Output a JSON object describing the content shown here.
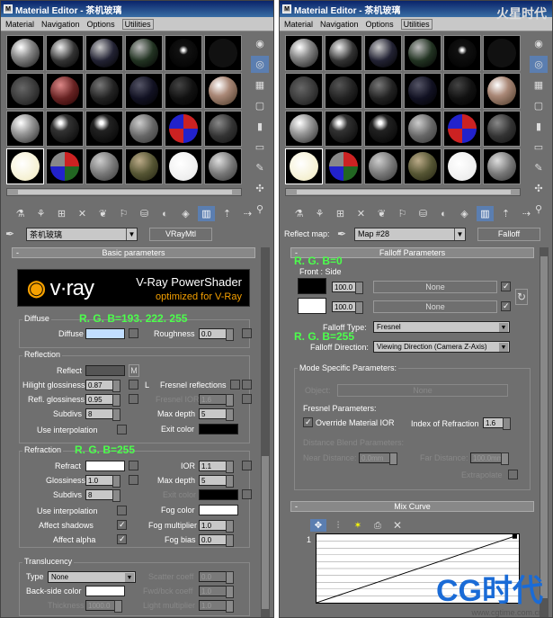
{
  "left": {
    "title": "Material Editor - 茶机玻璃",
    "menu": [
      "Material",
      "Navigation",
      "Options",
      "Utilities"
    ],
    "material_name": "茶机玻璃",
    "material_type": "VRayMtl",
    "rollout": "Basic parameters",
    "banner": {
      "logo": "v·ray",
      "line1": "V-Ray PowerShader",
      "line2": "optimized for V-Ray"
    },
    "diffuse": {
      "group": "Diffuse",
      "label": "Diffuse",
      "roughness_label": "Roughness",
      "roughness": "0.0"
    },
    "reflection": {
      "group": "Reflection",
      "reflect": "Reflect",
      "m": "M",
      "hilight_label": "Hilight glossiness",
      "hilight": "0.87",
      "l": "L",
      "fresnel_label": "Fresnel reflections",
      "refl_gloss_label": "Refl. glossiness",
      "refl_gloss": "0.95",
      "fresnel_ior_label": "Fresnel IOR",
      "fresnel_ior": "1.6",
      "subdivs_label": "Subdivs",
      "subdivs": "8",
      "maxdepth_label": "Max depth",
      "maxdepth": "5",
      "interp_label": "Use interpolation",
      "exit_label": "Exit color"
    },
    "refraction": {
      "group": "Refraction",
      "refract": "Refract",
      "ior_label": "IOR",
      "ior": "1.1",
      "gloss_label": "Glossiness",
      "gloss": "1.0",
      "maxdepth_label": "Max depth",
      "maxdepth": "5",
      "subdivs_label": "Subdivs",
      "subdivs": "8",
      "exit_label": "Exit color",
      "interp_label": "Use interpolation",
      "fog_label": "Fog color",
      "shadows_label": "Affect shadows",
      "fogmult_label": "Fog multiplier",
      "fogmult": "1.0",
      "alpha_label": "Affect alpha",
      "fogbias_label": "Fog bias",
      "fogbias": "0.0"
    },
    "translucency": {
      "group": "Translucency",
      "type_label": "Type",
      "type": "None",
      "scatter_label": "Scatter coeff",
      "scatter": "0.0",
      "backside_label": "Back-side color",
      "fwdbck_label": "Fwd/bck coeff",
      "fwdbck": "1.0",
      "thickness_label": "Thickness",
      "thickness": "1000.0",
      "light_label": "Light multiplier",
      "light": "1.0"
    },
    "annotations": {
      "diffuse": "R. G. B=193. 222. 255",
      "refract": "R. G. B=255"
    }
  },
  "right": {
    "title": "Material Editor - 茶机玻璃",
    "menu": [
      "Material",
      "Navigation",
      "Options",
      "Utilities"
    ],
    "reflect_map_label": "Reflect map:",
    "map_name": "Map #28",
    "map_type": "Falloff",
    "rollout": "Falloff Parameters",
    "front_side": "Front : Side",
    "v1": "100.0",
    "v2": "100.0",
    "none": "None",
    "falloff_type_label": "Falloff Type:",
    "falloff_type": "Fresnel",
    "falloff_dir_label": "Falloff Direction:",
    "falloff_dir": "Viewing Direction (Camera Z-Axis)",
    "mode_group": "Mode Specific Parameters:",
    "object_label": "Object:",
    "object_btn": "None",
    "fresnel_group": "Fresnel Parameters:",
    "override_label": "Override Material IOR",
    "ior_label": "Index of Refraction",
    "ior": "1.6",
    "distance_group": "Distance Blend Parameters:",
    "near_label": "Near Distance:",
    "near": "0.0mm",
    "far_label": "Far Distance:",
    "far": "100.0mm",
    "extrap_label": "Extrapolate",
    "mix_rollout": "Mix Curve",
    "curve_index": "1",
    "annotations": {
      "top": "R. G. B=0",
      "mid": "R. G. B=255"
    },
    "watermark_top": "火星时代",
    "watermark_bottom": "CG时代",
    "watermark_url": "www.cgtime.com.cn"
  }
}
